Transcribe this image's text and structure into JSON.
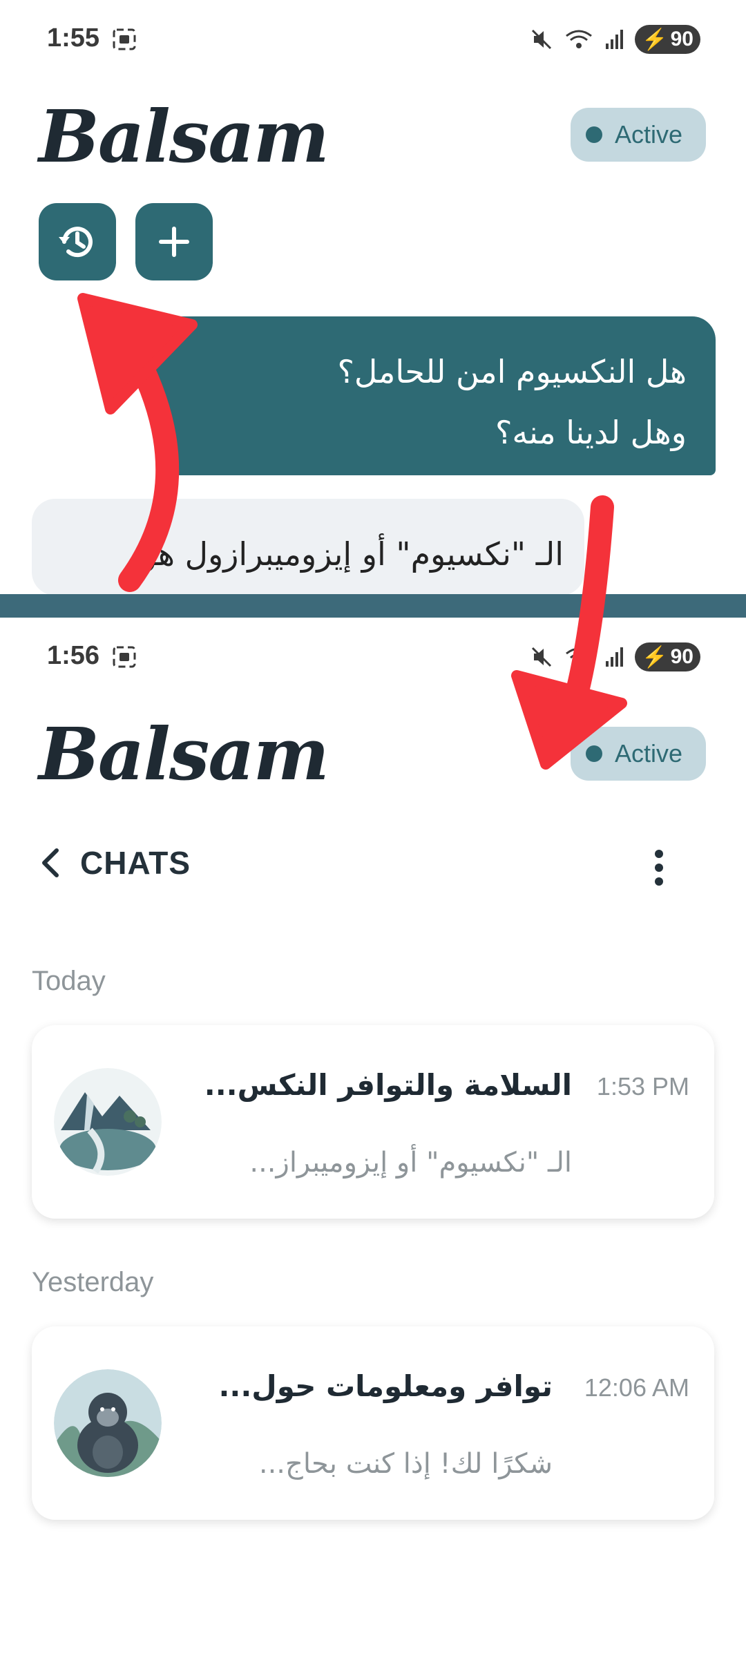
{
  "top": {
    "status": {
      "time": "1:55",
      "battery": "90"
    },
    "brand": "Balsam",
    "active_label": "Active",
    "user_message_line1": "هل النكسيوم امن للحامل؟",
    "user_message_line2": "وهل لدينا منه؟",
    "bot_message_partial": "الـ \"نكسيوم\" أو إيزوميبرازول هو"
  },
  "bottom": {
    "status": {
      "time": "1:56",
      "battery": "90"
    },
    "brand": "Balsam",
    "active_label": "Active",
    "chats_title": "CHATS",
    "sections": [
      {
        "label": "Today",
        "chat": {
          "title": "السلامة والتوافر النكس...",
          "time": "1:53 PM",
          "snippet": "الـ \"نكسيوم\" أو إيزوميبراز..."
        }
      },
      {
        "label": "Yesterday",
        "chat": {
          "title": "توافر ومعلومات حول...",
          "time": "12:06 AM",
          "snippet": "شكرًا لك! إذا كنت بحاج..."
        }
      }
    ]
  },
  "icons": {
    "history": "history-icon",
    "plus": "plus-icon",
    "back": "chevron-left-icon",
    "menu": "more-vertical-icon",
    "mute": "mute-icon",
    "wifi": "wifi-icon",
    "signal": "signal-icon",
    "screen": "screen-record-icon"
  },
  "colors": {
    "accent": "#2e6a74",
    "pill_bg": "#c4d8df",
    "divider": "#3d6a7a",
    "annotation_arrow": "#f4323a"
  }
}
